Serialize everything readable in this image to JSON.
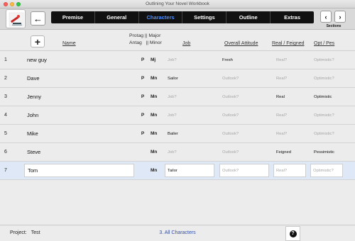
{
  "window": {
    "title": "Outlining Your Novel Workbook"
  },
  "toolbar": {
    "tabs": [
      {
        "label": "Premise"
      },
      {
        "label": "General"
      },
      {
        "label": "Characters",
        "active": true
      },
      {
        "label": "Settings"
      },
      {
        "label": "Outline"
      },
      {
        "label": "Extras"
      }
    ],
    "sections_prev_label": "‹",
    "sections_next_label": "›",
    "sections_caption": "Sections",
    "back_glyph": "←"
  },
  "columns": {
    "add_glyph": "+",
    "name": "Name",
    "protag_antag": [
      "Protag",
      "Antag"
    ],
    "sep": "||",
    "major_minor": [
      "Major",
      "Minor"
    ],
    "job": "Job",
    "attitude": "Overall Attitude",
    "real_feigned": "Real / Feigned",
    "opt_pes": "Opt / Pes"
  },
  "rows": [
    {
      "num": "1",
      "name": "new guy",
      "pa": "P",
      "mm": "Mj",
      "job": "Job?",
      "job_ph": true,
      "attitude": "Fresh",
      "att_ph": false,
      "real": "Real?",
      "real_ph": true,
      "opt": "Optimistic?",
      "opt_ph": true
    },
    {
      "num": "2",
      "name": "Dave",
      "pa": "P",
      "mm": "Mn",
      "job": "Sailor",
      "job_ph": false,
      "attitude": "Outlook?",
      "att_ph": true,
      "real": "Real?",
      "real_ph": true,
      "opt": "Optimistic?",
      "opt_ph": true
    },
    {
      "num": "3",
      "name": "Jenny",
      "pa": "P",
      "mm": "Mn",
      "job": "Job?",
      "job_ph": true,
      "attitude": "Outlook?",
      "att_ph": true,
      "real": "Real",
      "real_ph": false,
      "opt": "Optimistic",
      "opt_ph": false
    },
    {
      "num": "4",
      "name": "John",
      "pa": "P",
      "mm": "Mn",
      "job": "Job?",
      "job_ph": true,
      "attitude": "Outlook?",
      "att_ph": true,
      "real": "Real?",
      "real_ph": true,
      "opt": "Optimistic?",
      "opt_ph": true
    },
    {
      "num": "5",
      "name": "Mike",
      "pa": "P",
      "mm": "Mn",
      "job": "Bailer",
      "job_ph": false,
      "attitude": "Outlook?",
      "att_ph": true,
      "real": "Real?",
      "real_ph": true,
      "opt": "Optimistic?",
      "opt_ph": true
    },
    {
      "num": "6",
      "name": "Steve",
      "pa": "",
      "mm": "Mn",
      "job": "Job?",
      "job_ph": true,
      "attitude": "Outlook?",
      "att_ph": true,
      "real": "Feigned",
      "real_ph": false,
      "opt": "Pessimistic",
      "opt_ph": false
    },
    {
      "num": "7",
      "name": "Tom",
      "pa": "",
      "mm": "Mn",
      "job": "Tailor",
      "job_ph": false,
      "attitude": "Outlook?",
      "att_ph": true,
      "real": "Real?",
      "real_ph": true,
      "opt": "Optimistic?",
      "opt_ph": true,
      "selected": true
    }
  ],
  "footer": {
    "project_label": "Project:",
    "project_name": "Test",
    "breadcrumb": "3. All Characters",
    "help_glyph": "?"
  }
}
